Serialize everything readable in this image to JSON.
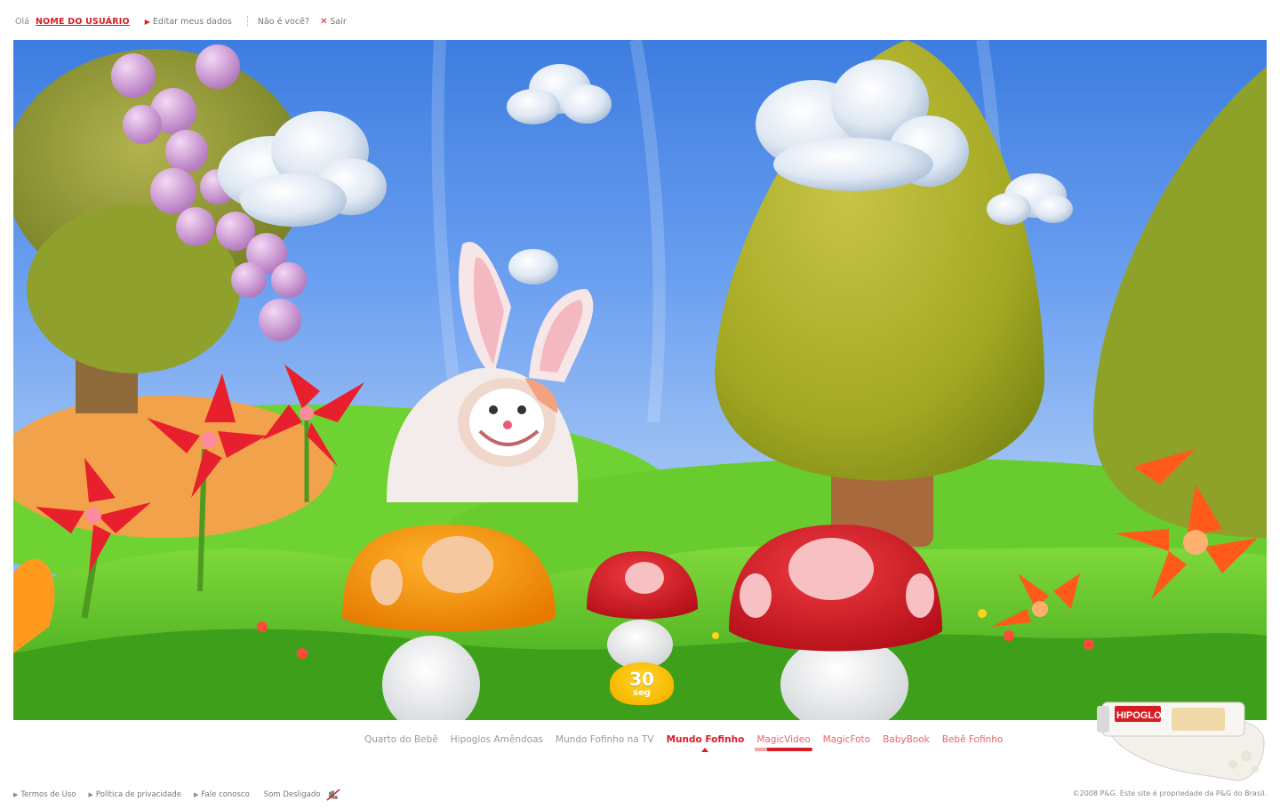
{
  "header": {
    "greeting": "Olá",
    "username": "NOME DO USUÁRIO",
    "edit_label": "Editar meus dados",
    "not_you_label": "Não é você?",
    "logout_label": "Sair"
  },
  "stage": {
    "timer_value": "30",
    "timer_unit": "seg"
  },
  "nav": {
    "items": [
      {
        "label": "Quarto do Bebê"
      },
      {
        "label": "Hipoglos Amêndoas"
      },
      {
        "label": "Mundo Fofinho na TV"
      },
      {
        "label": "Mundo Fofinho"
      },
      {
        "label": "MagicVideo"
      },
      {
        "label": "MagicFoto"
      },
      {
        "label": "BabyBook"
      },
      {
        "label": "Bebê Fofinho"
      }
    ],
    "active": "Mundo Fofinho",
    "current_sub": "MagicVideo"
  },
  "footer": {
    "terms_label": "Termos de Uso",
    "privacy_label": "Política de privacidade",
    "contact_label": "Fale conosco",
    "sound_label": "Som Desligado",
    "copyright": "©2008 P&G. Este site é propriedade da P&G do Brasil."
  },
  "product": {
    "brand": "HIPOGLOS"
  },
  "colors": {
    "brand_red": "#d71d24",
    "link_pink": "#e9646b",
    "sky": "#6a9ff0",
    "grass": "#5cc52a"
  }
}
